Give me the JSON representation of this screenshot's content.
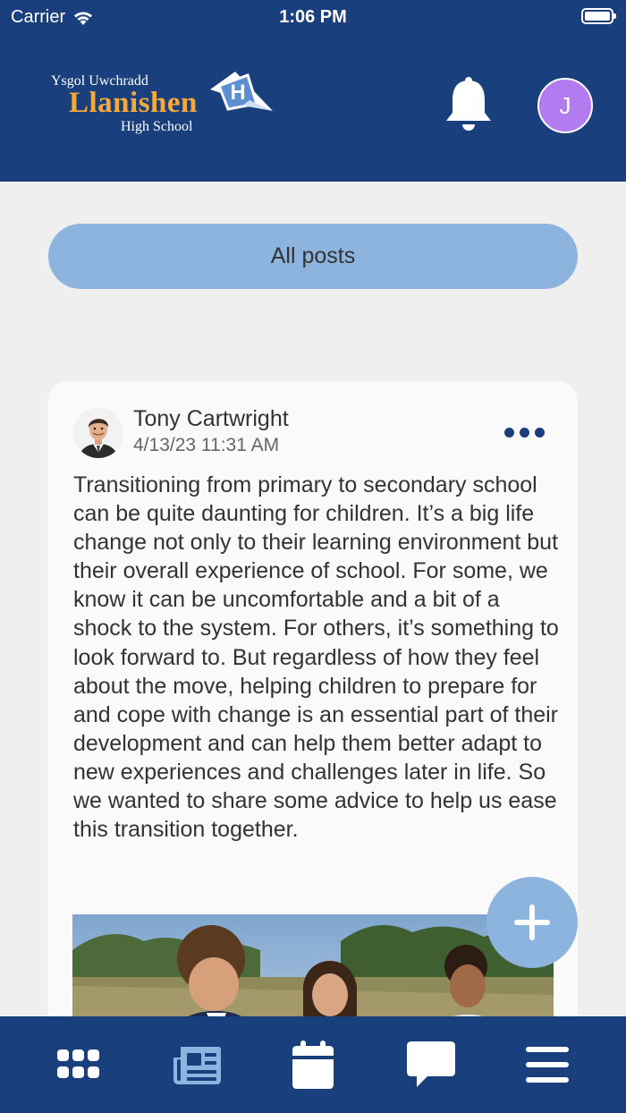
{
  "status_bar": {
    "carrier": "Carrier",
    "time": "1:06 PM"
  },
  "header": {
    "logo": {
      "line1": "Ysgol Uwchradd",
      "line2": "Llanishen",
      "line3": "High School",
      "emblem_letter": "H"
    },
    "user_initial": "J"
  },
  "filter": {
    "label": "All posts"
  },
  "post": {
    "author": "Tony Cartwright",
    "timestamp": "4/13/23 11:31 AM",
    "body": "Transitioning from primary to secondary school can be quite daunting for children. It’s a big life change not only to their learning environment but their overall experience of school. For some, we know it can be uncomfortable and a bit of a shock to the system. For others, it’s something to look forward to. But regardless of how they feel about the move, helping children to prepare for and cope with change is an essential part of their development and can help them better adapt to new experiences and challenges later in life. So we wanted to share some advice to help us ease this transition together."
  },
  "colors": {
    "brand_navy": "#1a3f7d",
    "accent_blue": "#8db3df",
    "logo_orange": "#f4a93a",
    "avatar_purple": "#b37bf0"
  },
  "icons": {
    "status": [
      "wifi-icon",
      "battery-icon"
    ],
    "header": [
      "bell-icon"
    ],
    "post": [
      "more-options-icon"
    ],
    "fab": "plus-icon",
    "tabs": [
      "grid-icon",
      "newspaper-icon",
      "calendar-icon",
      "chat-icon",
      "menu-icon"
    ]
  }
}
